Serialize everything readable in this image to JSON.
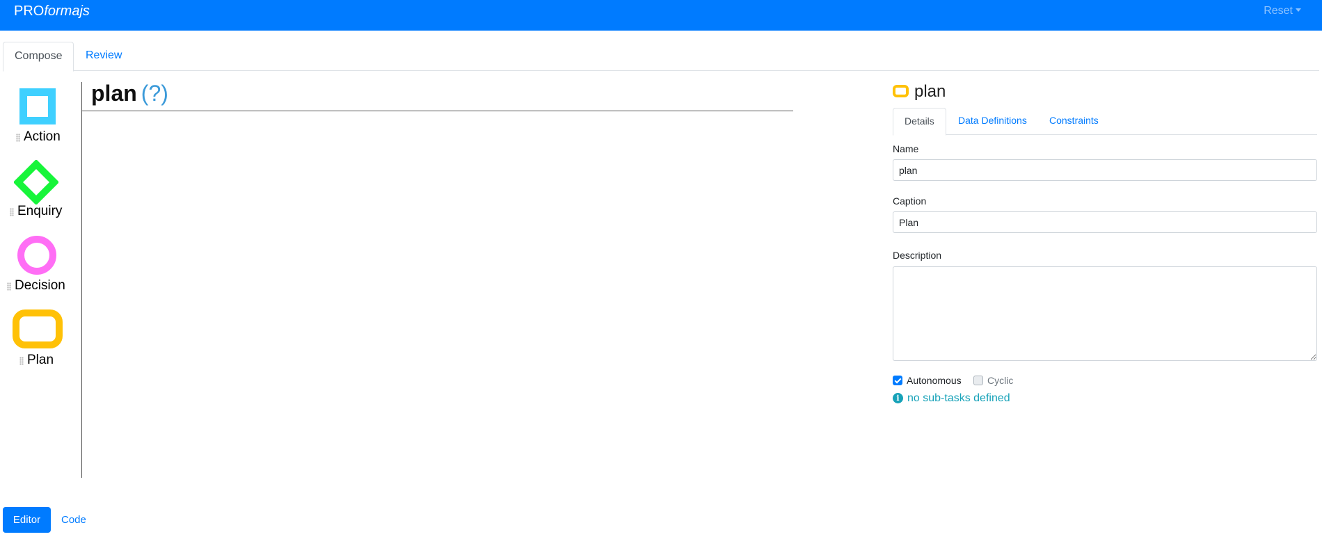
{
  "navbar": {
    "brand_prefix": "PRO",
    "brand_italic": "formajs",
    "reset_label": "Reset",
    "color": "#007bff"
  },
  "top_tabs": [
    {
      "label": "Compose",
      "active": true
    },
    {
      "label": "Review",
      "active": false
    }
  ],
  "palette": {
    "items": [
      {
        "label": "Action",
        "icon": "action-square-icon",
        "color": "#3fd0ff"
      },
      {
        "label": "Enquiry",
        "icon": "enquiry-diamond-icon",
        "color": "#17f53a"
      },
      {
        "label": "Decision",
        "icon": "decision-circle-icon",
        "color": "#ff6ef5"
      },
      {
        "label": "Plan",
        "icon": "plan-rounded-rect-icon",
        "color": "#ffc107"
      }
    ]
  },
  "canvas": {
    "title": "plan",
    "help_link": "(?)"
  },
  "properties": {
    "header_title": "plan",
    "header_icon": "plan-rounded-rect-icon",
    "tabs": [
      {
        "label": "Details",
        "active": true
      },
      {
        "label": "Data Definitions",
        "active": false
      },
      {
        "label": "Constraints",
        "active": false
      }
    ],
    "name_label": "Name",
    "name_value": "plan",
    "caption_label": "Caption",
    "caption_value": "Plan",
    "description_label": "Description",
    "description_value": "",
    "autonomous_label": "Autonomous",
    "autonomous_checked": true,
    "cyclic_label": "Cyclic",
    "cyclic_checked": false,
    "info_icon": "info-icon",
    "info_text": "no sub-tasks defined"
  },
  "footer": {
    "editor_label": "Editor",
    "code_label": "Code"
  }
}
